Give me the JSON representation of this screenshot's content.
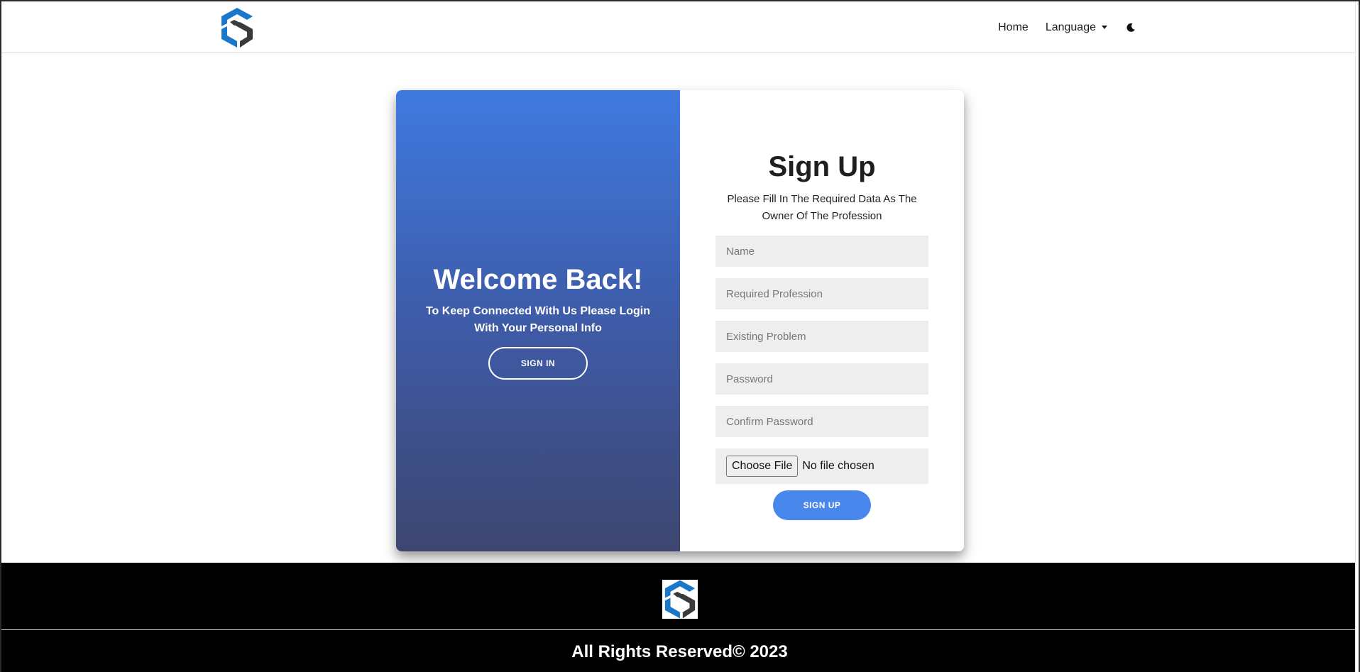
{
  "navbar": {
    "home_label": "Home",
    "language_label": "Language",
    "theme_toggle_icon": "moon-icon",
    "logo_icon": "brand-logo-icon"
  },
  "overlay": {
    "title": "Welcome Back!",
    "subtitle": "To Keep Connected With Us Please Login With Your Personal Info",
    "sign_in_label": "SIGN IN"
  },
  "form": {
    "title": "Sign Up",
    "subtitle": "Please Fill In The Required Data As The Owner Of The Profession",
    "name_placeholder": "Name",
    "profession_placeholder": "Required Profession",
    "problem_placeholder": "Existing Problem",
    "password_placeholder": "Password",
    "confirm_password_placeholder": "Confirm Password",
    "file_button_label": "Choose File",
    "file_status": "No file chosen",
    "sign_up_label": "SIGN UP"
  },
  "footer": {
    "copyright": "All Rights Reserved© 2023"
  },
  "colors": {
    "primary_blue": "#4a87ec",
    "logo_blue": "#1b78c8",
    "logo_dark": "#3a3a3a",
    "gradient_top": "#3f7ae0",
    "gradient_bottom": "#3d4670"
  }
}
